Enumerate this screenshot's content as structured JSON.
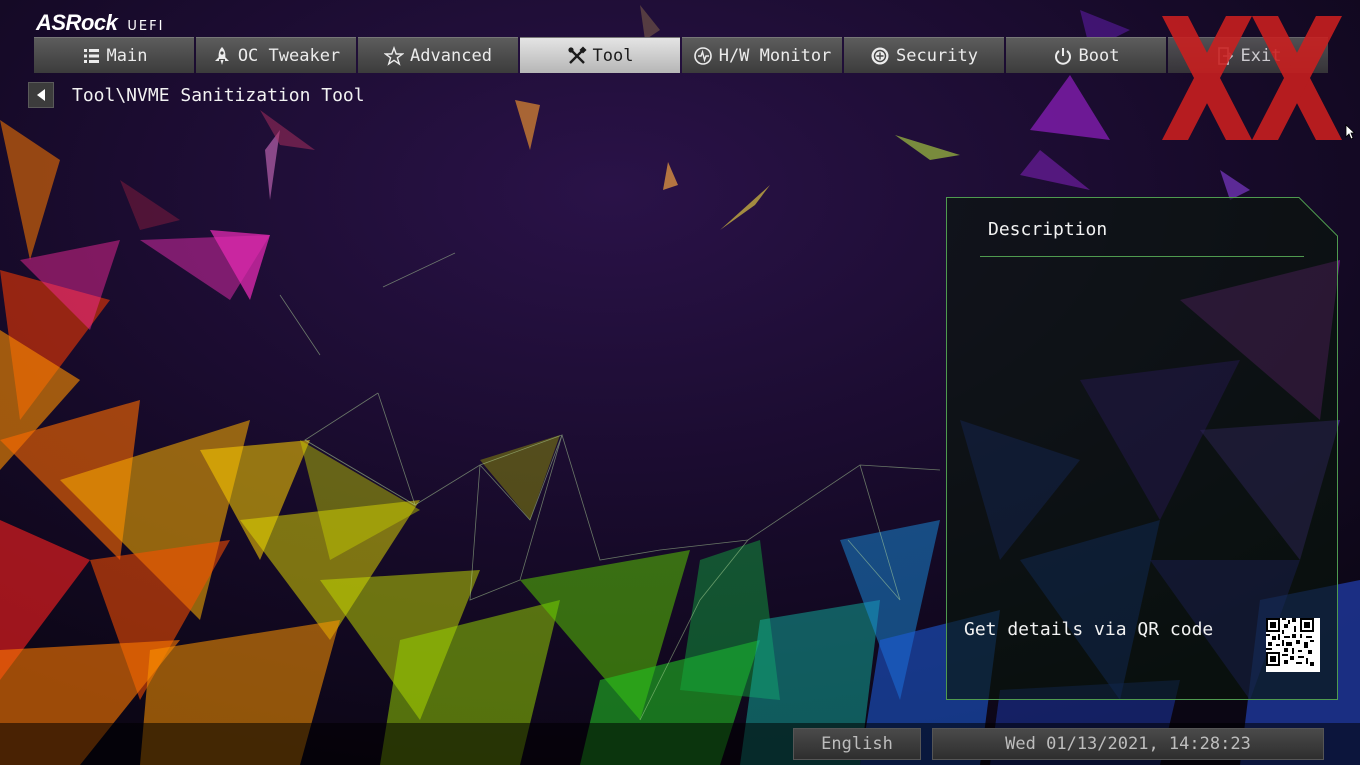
{
  "brand": {
    "logo": "ASRock",
    "subtitle": "UEFI"
  },
  "tabs": [
    {
      "label": "Main",
      "icon": "list-icon",
      "active": false
    },
    {
      "label": "OC Tweaker",
      "icon": "rocket-icon",
      "active": false
    },
    {
      "label": "Advanced",
      "icon": "star-icon",
      "active": false
    },
    {
      "label": "Tool",
      "icon": "tools-icon",
      "active": true
    },
    {
      "label": "H/W Monitor",
      "icon": "monitor-icon",
      "active": false
    },
    {
      "label": "Security",
      "icon": "shield-icon",
      "active": false
    },
    {
      "label": "Boot",
      "icon": "power-icon",
      "active": false
    },
    {
      "label": "Exit",
      "icon": "exit-icon",
      "active": false
    }
  ],
  "breadcrumb": {
    "path": "Tool\\NVME Sanitization Tool"
  },
  "description": {
    "title": "Description",
    "qr_text": "Get details via QR code"
  },
  "footer": {
    "language": "English",
    "datetime": "Wed 01/13/2021, 14:28:23"
  },
  "colors": {
    "active_tab": "#d0d0d0",
    "panel_border": "#4f9a4f",
    "watermark": "#cc1f1f"
  }
}
